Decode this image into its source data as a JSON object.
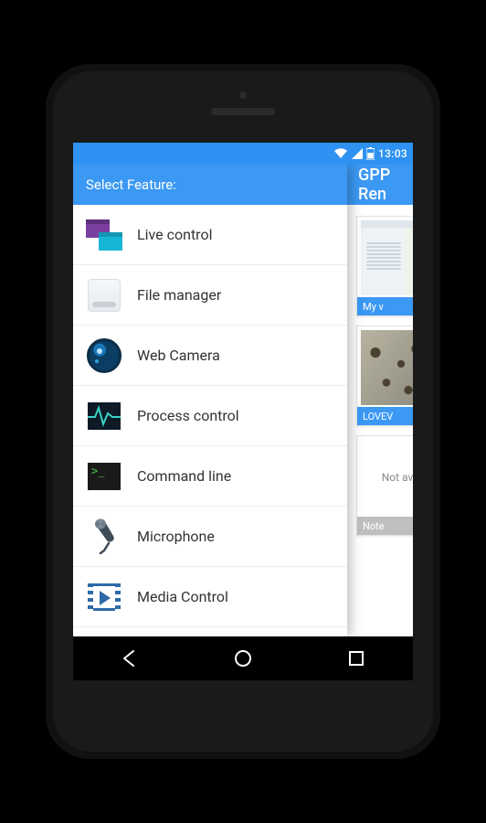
{
  "status": {
    "time": "13:03"
  },
  "back": {
    "title": "GPP Ren",
    "card1_caption": "My v",
    "card2_caption": "LOVEV",
    "card3_text": "Not av",
    "card3_caption": "Note"
  },
  "drawer": {
    "header": "Select Feature:",
    "items": [
      {
        "label": "Live control"
      },
      {
        "label": "File manager"
      },
      {
        "label": "Web Camera"
      },
      {
        "label": "Process control"
      },
      {
        "label": "Command line"
      },
      {
        "label": "Microphone"
      },
      {
        "label": "Media Control"
      }
    ]
  }
}
